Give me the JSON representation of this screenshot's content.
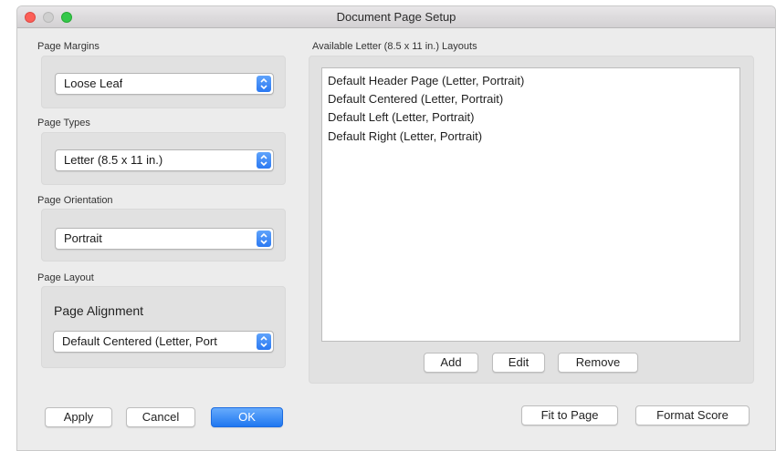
{
  "window": {
    "title": "Document Page Setup"
  },
  "left": {
    "margins_label": "Page Margins",
    "margins_value": "Loose Leaf",
    "types_label": "Page Types",
    "types_value": "Letter (8.5 x 11 in.)",
    "orientation_label": "Page Orientation",
    "orientation_value": "Portrait",
    "layout_label": "Page Layout",
    "alignment_label": "Page Alignment",
    "alignment_value": "Default Centered (Letter, Port"
  },
  "right": {
    "layouts_label": "Available Letter (8.5 x 11 in.) Layouts",
    "layouts": [
      "Default Header Page (Letter, Portrait)",
      "Default Centered (Letter, Portrait)",
      "Default Left (Letter, Portrait)",
      "Default Right (Letter, Portrait)"
    ],
    "add_label": "Add",
    "edit_label": "Edit",
    "remove_label": "Remove"
  },
  "footer": {
    "apply_label": "Apply",
    "cancel_label": "Cancel",
    "ok_label": "OK",
    "fit_label": "Fit to Page",
    "format_label": "Format Score"
  },
  "colors": {
    "accent": "#2b79f2",
    "close": "#fc5f57",
    "maximize": "#34c84a"
  },
  "icons": {
    "popup": "up-down-chevron-icon"
  }
}
